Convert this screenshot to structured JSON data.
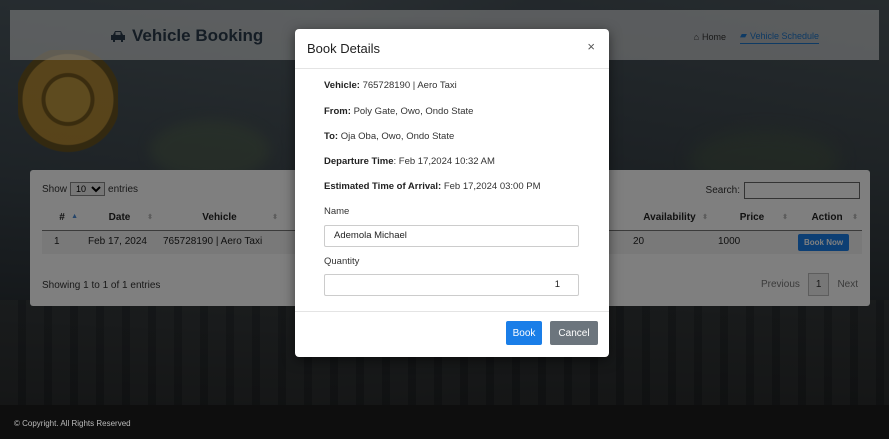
{
  "header": {
    "brand": "Vehicle Booking",
    "nav": [
      {
        "label": "Home",
        "icon": "home-icon"
      },
      {
        "label": "Vehicle Schedule",
        "icon": "car-icon"
      }
    ]
  },
  "table": {
    "show_prefix": "Show",
    "show_value": "10",
    "show_suffix": "entries",
    "search_label": "Search:",
    "columns": [
      "#",
      "Date",
      "Vehicle",
      "Availability",
      "Price",
      "Action"
    ],
    "rows": [
      {
        "num": "1",
        "date": "Feb 17, 2024",
        "vehicle": "765728190 | Aero Taxi",
        "availability": "20",
        "price": "1000",
        "action": "Book Now"
      }
    ],
    "info": "Showing 1 to 1 of 1 entries",
    "pager": {
      "previous": "Previous",
      "current": "1",
      "next": "Next"
    }
  },
  "modal": {
    "title": "Book Details",
    "close": "×",
    "vehicle_label": "Vehicle:",
    "vehicle_value": "765728190 | Aero Taxi",
    "from_label": "From:",
    "from_value": "Poly Gate, Owo, Ondo State",
    "to_label": "To:",
    "to_value": "Oja Oba, Owo, Ondo State",
    "departure_label": "Departure Time",
    "departure_value": ": Feb 17,2024 10:32 AM",
    "eta_label": "Estimated Time of Arrival:",
    "eta_value": "Feb 17,2024 03:00 PM",
    "name_label": "Name",
    "name_value": "Ademola Michael",
    "quantity_label": "Quantity",
    "quantity_value": "1",
    "book_label": "Book",
    "cancel_label": "Cancel"
  },
  "footer": {
    "text": "© Copyright. All Rights Reserved"
  }
}
